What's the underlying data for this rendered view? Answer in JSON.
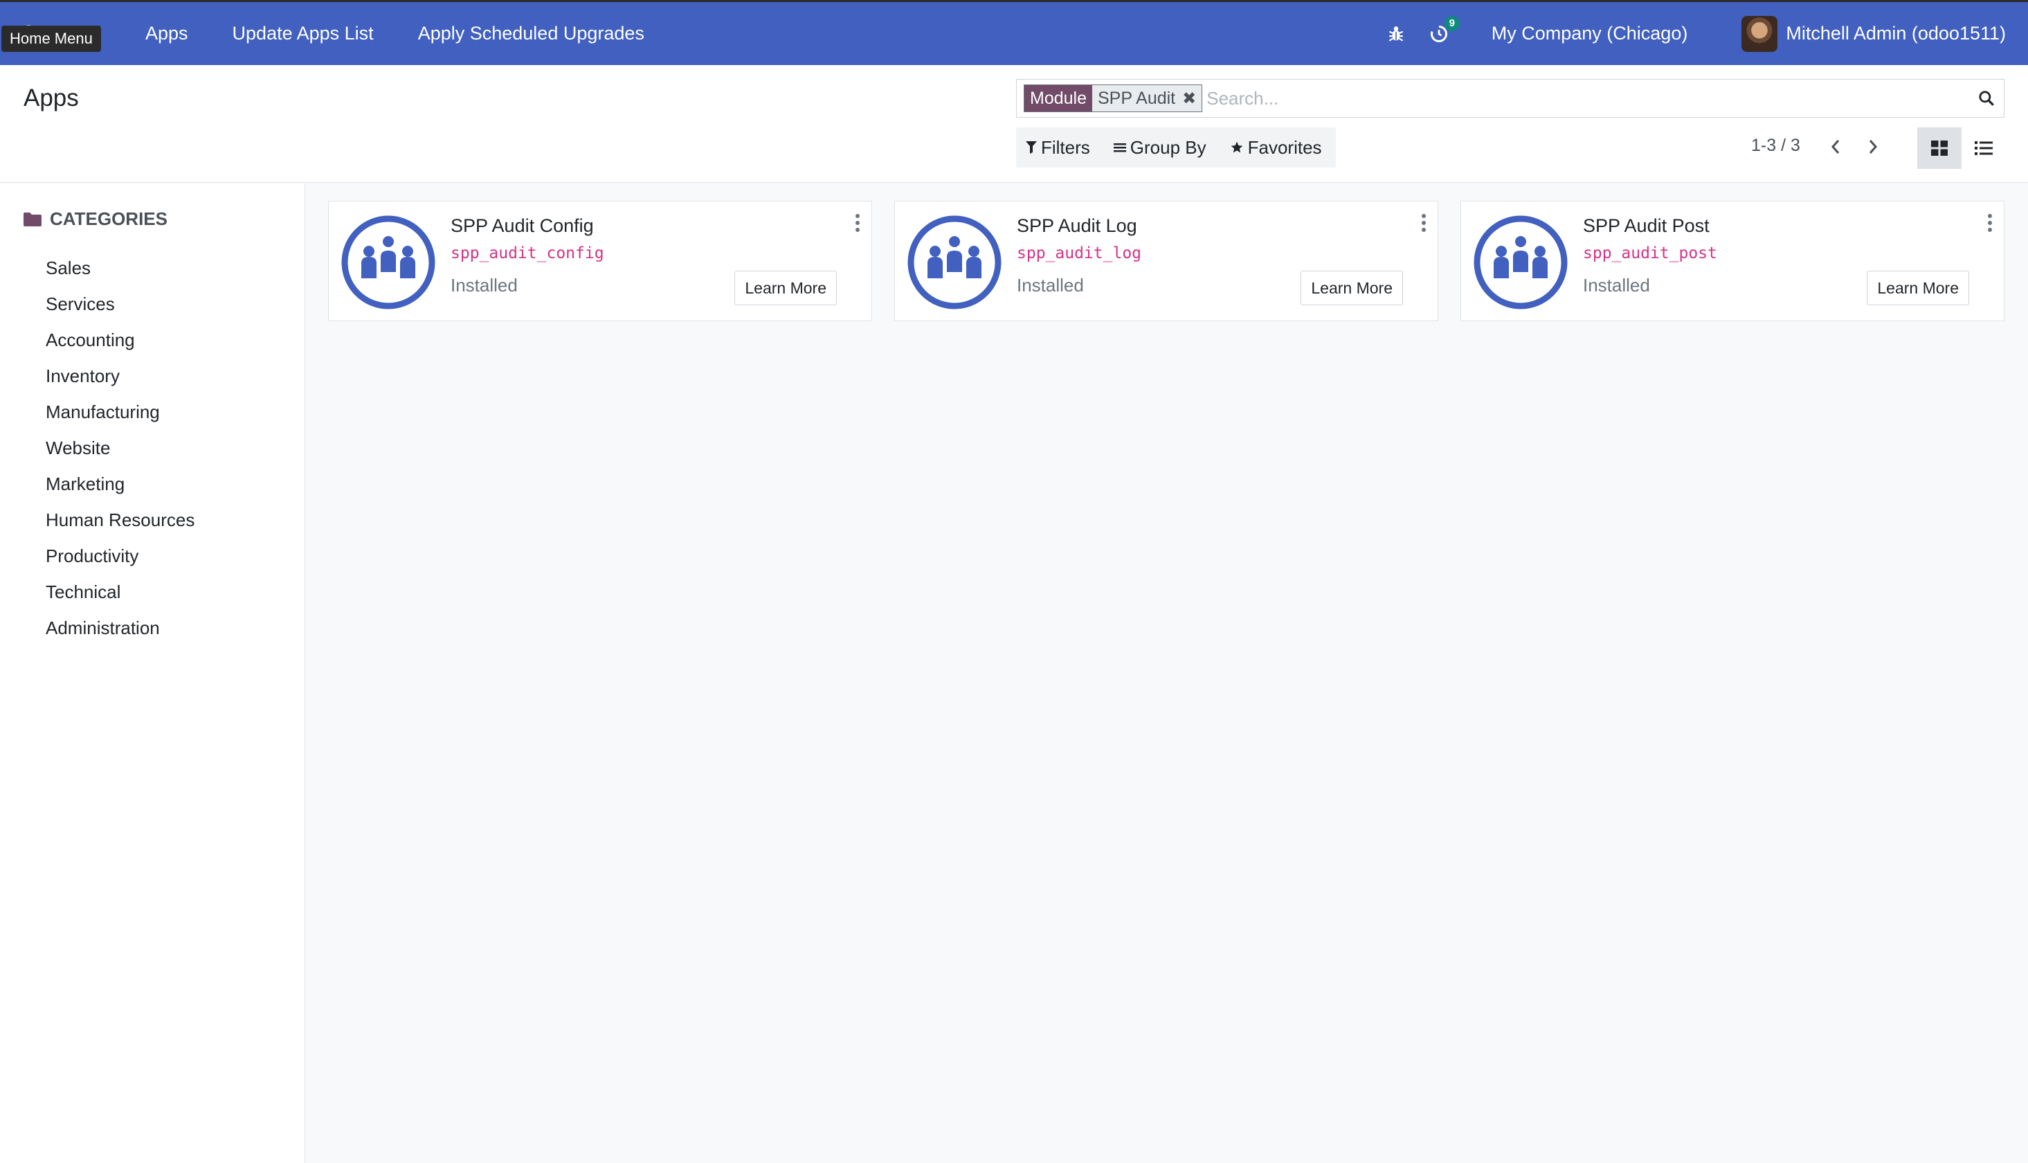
{
  "navbar": {
    "brand": "Apps",
    "tooltip": "Home Menu",
    "menu": [
      "Apps",
      "Update Apps List",
      "Apply Scheduled Upgrades"
    ],
    "activity_count": "9",
    "company": "My Company (Chicago)",
    "user": "Mitchell Admin (odoo1511)",
    "accent_color": "#4160bf"
  },
  "control_panel": {
    "title": "Apps",
    "search": {
      "facet_label": "Module",
      "facet_value": "SPP Audit",
      "placeholder": "Search..."
    },
    "filters_label": "Filters",
    "group_by_label": "Group By",
    "favorites_label": "Favorites",
    "pager": "1-3 / 3",
    "active_view": "kanban"
  },
  "sidebar": {
    "header": "CATEGORIES",
    "categories": [
      "Sales",
      "Services",
      "Accounting",
      "Inventory",
      "Manufacturing",
      "Website",
      "Marketing",
      "Human Resources",
      "Productivity",
      "Technical",
      "Administration"
    ]
  },
  "modules": [
    {
      "name": "SPP Audit Config",
      "technical_name": "spp_audit_config",
      "status": "Installed",
      "button": "Learn More",
      "icon": "people-group-icon"
    },
    {
      "name": "SPP Audit Log",
      "technical_name": "spp_audit_log",
      "status": "Installed",
      "button": "Learn More",
      "icon": "people-group-icon"
    },
    {
      "name": "SPP Audit Post",
      "technical_name": "spp_audit_post",
      "status": "Installed",
      "button": "Learn More",
      "icon": "people-group-icon"
    }
  ]
}
